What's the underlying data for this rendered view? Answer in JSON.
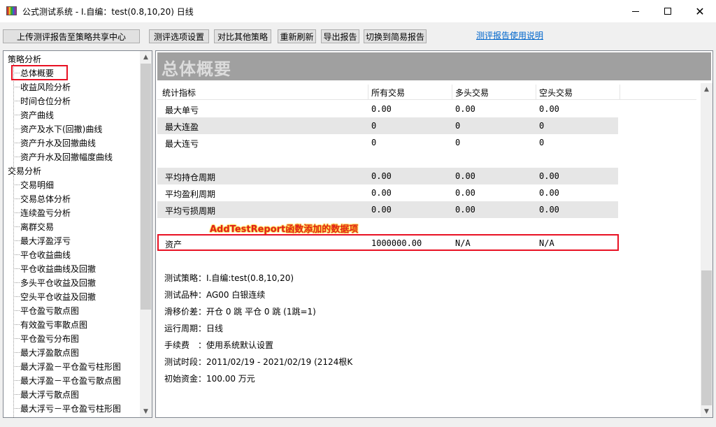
{
  "window": {
    "title": "公式测试系统 - I.自编：test(0.8,10,20) 日线",
    "minimize_glyph": "",
    "maximize_glyph": "",
    "close_glyph": "✕"
  },
  "toolbar": {
    "upload_label": "上传测评报告至策略共享中心",
    "options_label": "测评选项设置",
    "compare_label": "对比其他策略",
    "refresh_label": "重新刷新",
    "export_label": "导出报告",
    "simple_label": "切换到简易报告",
    "help_link": "测评报告使用说明"
  },
  "sidebar": {
    "groups": [
      {
        "label": "策略分析",
        "items": [
          "总体概要",
          "收益风险分析",
          "时间仓位分析",
          "资产曲线",
          "资产及水下(回撤)曲线",
          "资产升水及回撤曲线",
          "资产升水及回撤幅度曲线"
        ]
      },
      {
        "label": "交易分析",
        "items": [
          "交易明细",
          "交易总体分析",
          "连续盈亏分析",
          "离群交易",
          "最大浮盈浮亏",
          "平仓收益曲线",
          "平仓收益曲线及回撤",
          "多头平仓收益及回撤",
          "空头平仓收益及回撤",
          "平仓盈亏散点图",
          "有效盈亏率散点图",
          "平仓盈亏分布图",
          "最大浮盈散点图",
          "最大浮盈－平仓盈亏柱形图",
          "最大浮盈－平仓盈亏散点图",
          "最大浮亏散点图",
          "最大浮亏－平仓盈亏柱形图"
        ]
      }
    ],
    "selected": "总体概要",
    "up_arrow": "▲",
    "down_arrow": "▼"
  },
  "main": {
    "title": "总体概要",
    "columns": [
      "统计指标",
      "所有交易",
      "多头交易",
      "空头交易"
    ],
    "rows": [
      {
        "label": "最大单亏",
        "all": "0.00",
        "long": "0.00",
        "short": "0.00",
        "shade": false
      },
      {
        "label": "最大连盈",
        "all": "0",
        "long": "0",
        "short": "0",
        "shade": true
      },
      {
        "label": "最大连亏",
        "all": "0",
        "long": "0",
        "short": "0",
        "shade": false
      },
      {
        "label": "",
        "all": "",
        "long": "",
        "short": "",
        "shade": false
      },
      {
        "label": "平均持仓周期",
        "all": "0.00",
        "long": "0.00",
        "short": "0.00",
        "shade": true
      },
      {
        "label": "平均盈利周期",
        "all": "0.00",
        "long": "0.00",
        "short": "0.00",
        "shade": false
      },
      {
        "label": "平均亏损周期",
        "all": "0.00",
        "long": "0.00",
        "short": "0.00",
        "shade": true
      }
    ],
    "annotation": "AddTestReport函数添加的数据项",
    "asset_row": {
      "label": "资产",
      "all": "1000000.00",
      "long": "N/A",
      "short": "N/A"
    },
    "info": [
      "测试策略：I.自编:test(0.8,10,20)",
      "测试品种：AG00 白银连续",
      "滑移价差：开仓 0 跳 平仓 0 跳 (1跳=1)",
      "运行周期：日线",
      "手续费　：使用系统默认设置",
      "测试时段：2011/02/19 - 2021/02/19 (2124根K",
      "初始资金：100.00 万元"
    ],
    "up_arrow": "▲",
    "down_arrow": "▼"
  }
}
